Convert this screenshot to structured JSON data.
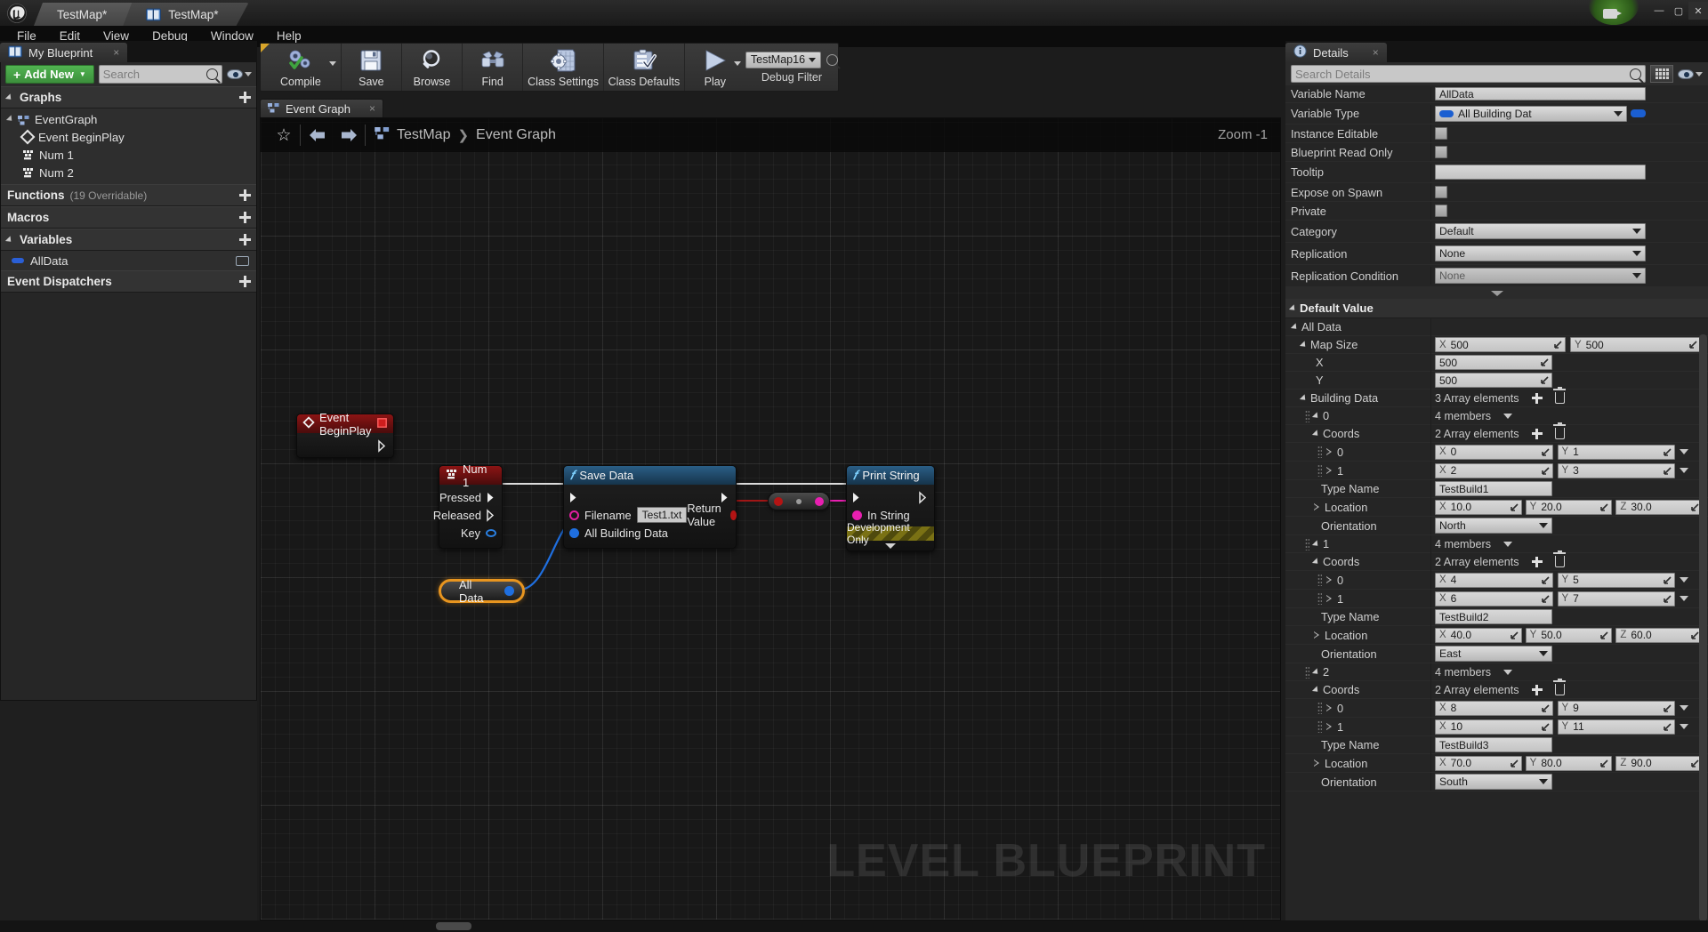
{
  "window": {
    "app_tab_label": "TestMap*",
    "doc_tab_label": "TestMap*",
    "minimize": "—",
    "maximize": "▢",
    "close": "✕"
  },
  "menu": {
    "items": [
      "File",
      "Edit",
      "View",
      "Debug",
      "Window",
      "Help"
    ]
  },
  "my_blueprint": {
    "tab_label": "My Blueprint",
    "tab_close": "×",
    "add_new_label": "Add New",
    "add_new_plus": "+",
    "search_placeholder": "Search",
    "sections": {
      "graphs": {
        "label": "Graphs",
        "add": "+"
      },
      "functions": {
        "label": "Functions",
        "suffix": "(19 Overridable)",
        "add": "+"
      },
      "macros": {
        "label": "Macros",
        "add": "+"
      },
      "variables": {
        "label": "Variables",
        "add": "+"
      },
      "event_dispatchers": {
        "label": "Event Dispatchers",
        "add": "+"
      }
    },
    "graph_tree": [
      {
        "label": "EventGraph",
        "icon": "graph-icon",
        "depth": 0
      },
      {
        "label": "Event BeginPlay",
        "icon": "event-diamond-icon",
        "depth": 1
      },
      {
        "label": "Num 1",
        "icon": "keyboard-icon",
        "depth": 1
      },
      {
        "label": "Num 2",
        "icon": "keyboard-icon",
        "depth": 1
      }
    ],
    "variables": [
      {
        "label": "AllData",
        "icon": "variable-pill-icon"
      }
    ]
  },
  "toolbar": {
    "items": [
      {
        "label": "Compile",
        "icon": "compile-gears-icon",
        "has_caret": true
      },
      {
        "label": "Save",
        "icon": "floppy-disk-icon",
        "has_caret": false
      },
      {
        "label": "Browse",
        "icon": "magnifier-icon",
        "has_caret": false
      },
      {
        "label": "Find",
        "icon": "binoculars-icon",
        "has_caret": false
      },
      {
        "label": "Class Settings",
        "icon": "class-settings-icon",
        "has_caret": false
      },
      {
        "label": "Class Defaults",
        "icon": "class-defaults-icon",
        "has_caret": false
      },
      {
        "label": "Play",
        "icon": "play-triangle-icon",
        "has_caret": true
      }
    ],
    "debug_filter": {
      "value": "TestMap16",
      "label": "Debug Filter",
      "search_icon": "magnifier-icon"
    }
  },
  "graph": {
    "tab_label": "Event Graph",
    "tab_close": "×",
    "breadcrumb": {
      "root": "TestMap",
      "chevron": "❯",
      "current": "Event Graph"
    },
    "zoom_label": "Zoom -1",
    "watermark": "LEVEL BLUEPRINT",
    "nodes": {
      "event_begin_play": {
        "title": "Event BeginPlay",
        "icon": "event-diamond-icon",
        "badge": "delegate-square-icon"
      },
      "num1": {
        "title": "Num 1",
        "icon": "keyboard-icon",
        "pins": [
          {
            "label": "Pressed",
            "type": "exec-filled"
          },
          {
            "label": "Released",
            "type": "exec-hollow"
          },
          {
            "label": "Key",
            "type": "struct-ring"
          }
        ]
      },
      "save_data": {
        "title": "Save Data",
        "icon": "function-f-icon",
        "exec_in": "",
        "exec_out": "",
        "inputs": [
          {
            "label": "Filename",
            "value": "Test1.txt",
            "pin": "string-pin"
          },
          {
            "label": "All Building Data",
            "pin": "struct-pin"
          }
        ],
        "outputs": [
          {
            "label": "Return Value",
            "pin": "bool-pin"
          }
        ]
      },
      "print_string": {
        "title": "Print String",
        "icon": "function-f-icon",
        "inputs": [
          {
            "label": "In String",
            "pin": "string-pin"
          }
        ],
        "dev_only_banner": "Development Only",
        "collapse_icon": "chevron-down-icon"
      },
      "all_data_var": {
        "label": "All Data",
        "pin": "struct-pin"
      },
      "reroute": {
        "label": ""
      }
    }
  },
  "details": {
    "tab_label": "Details",
    "tab_close": "×",
    "tab_icon": "info-icon",
    "search_placeholder": "Search Details",
    "grid_button_icon": "grid-view-icon",
    "eye_icon": "eye-icon",
    "properties": [
      {
        "name": "Variable Name",
        "kind": "text",
        "value": "AllData",
        "clipped": true
      },
      {
        "name": "Variable Type",
        "kind": "type-combo",
        "value": "All Building Dat"
      },
      {
        "name": "Instance Editable",
        "kind": "checkbox",
        "value": ""
      },
      {
        "name": "Blueprint Read Only",
        "kind": "checkbox",
        "value": ""
      },
      {
        "name": "Tooltip",
        "kind": "text",
        "value": ""
      },
      {
        "name": "Expose on Spawn",
        "kind": "checkbox",
        "value": ""
      },
      {
        "name": "Private",
        "kind": "checkbox",
        "value": ""
      },
      {
        "name": "Category",
        "kind": "combo",
        "value": "Default"
      },
      {
        "name": "Replication",
        "kind": "combo",
        "value": "None"
      },
      {
        "name": "Replication Condition",
        "kind": "combo-muted",
        "value": "None"
      }
    ],
    "default_value": {
      "section_label": "Default Value",
      "root_label": "All Data",
      "map_size": {
        "label": "Map Size",
        "x_label": "X",
        "x_value": "500",
        "y_label": "Y",
        "y_value": "500",
        "child_x_label": "X",
        "child_x_value": "500",
        "child_y_label": "Y",
        "child_y_value": "500"
      },
      "building_data": {
        "label": "Building Data",
        "count_text": "3 Array elements",
        "add_icon": "plus-icon",
        "delete_icon": "trash-icon",
        "elements": [
          {
            "index": "0",
            "members_text": "4 members",
            "coords": {
              "label": "Coords",
              "count_text": "2 Array elements",
              "rows": [
                {
                  "index": "0",
                  "x_label": "X",
                  "x": "0",
                  "y_label": "Y",
                  "y": "1"
                },
                {
                  "index": "1",
                  "x_label": "X",
                  "x": "2",
                  "y_label": "Y",
                  "y": "3"
                }
              ]
            },
            "type_name_label": "Type Name",
            "type_name": "TestBuild1",
            "location_label": "Location",
            "location": {
              "x_label": "X",
              "x": "10.0",
              "y_label": "Y",
              "y": "20.0",
              "z_label": "Z",
              "z": "30.0"
            },
            "orientation_label": "Orientation",
            "orientation": "North"
          },
          {
            "index": "1",
            "members_text": "4 members",
            "coords": {
              "label": "Coords",
              "count_text": "2 Array elements",
              "rows": [
                {
                  "index": "0",
                  "x_label": "X",
                  "x": "4",
                  "y_label": "Y",
                  "y": "5"
                },
                {
                  "index": "1",
                  "x_label": "X",
                  "x": "6",
                  "y_label": "Y",
                  "y": "7"
                }
              ]
            },
            "type_name_label": "Type Name",
            "type_name": "TestBuild2",
            "location_label": "Location",
            "location": {
              "x_label": "X",
              "x": "40.0",
              "y_label": "Y",
              "y": "50.0",
              "z_label": "Z",
              "z": "60.0"
            },
            "orientation_label": "Orientation",
            "orientation": "East"
          },
          {
            "index": "2",
            "members_text": "4 members",
            "coords": {
              "label": "Coords",
              "count_text": "2 Array elements",
              "rows": [
                {
                  "index": "0",
                  "x_label": "X",
                  "x": "8",
                  "y_label": "Y",
                  "y": "9"
                },
                {
                  "index": "1",
                  "x_label": "X",
                  "x": "10",
                  "y_label": "Y",
                  "y": "11"
                }
              ]
            },
            "type_name_label": "Type Name",
            "type_name": "TestBuild3",
            "location_label": "Location",
            "location": {
              "x_label": "X",
              "x": "70.0",
              "y_label": "Y",
              "y": "80.0",
              "z_label": "Z",
              "z": "90.0"
            },
            "orientation_label": "Orientation",
            "orientation": "South"
          }
        ]
      }
    }
  },
  "colors": {
    "accent_orange": "#e8951f",
    "exec_white": "#ffffff",
    "string_pink": "#e81fb0",
    "struct_blue": "#1f6fe0",
    "bool_red": "#b31414",
    "event_red": "#8c1414",
    "function_blue": "#2a5e86",
    "add_new_green": "#3c8f3c"
  }
}
